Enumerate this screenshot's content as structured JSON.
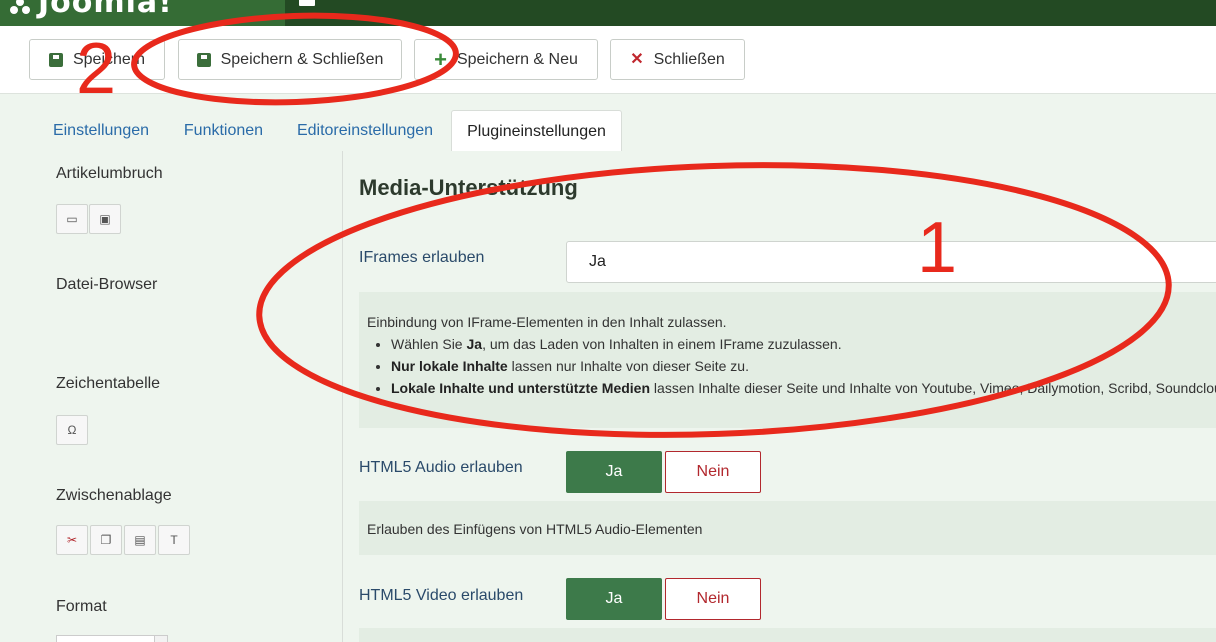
{
  "header": {
    "logo_text": "Joomla!",
    "accent_color": "#234a23"
  },
  "toolbar": {
    "save_label": "Speichern",
    "save_close_label": "Speichern & Schließen",
    "save_new_label": "Speichern & Neu",
    "close_label": "Schließen"
  },
  "tabs": [
    {
      "label": "Einstellungen"
    },
    {
      "label": "Funktionen"
    },
    {
      "label": "Editoreinstellungen"
    },
    {
      "label": "Plugineinstellungen",
      "active": true
    }
  ],
  "sidebar": {
    "sections": [
      {
        "label": "Artikelumbruch"
      },
      {
        "label": "Datei-Browser"
      },
      {
        "label": "Zeichentabelle"
      },
      {
        "label": "Zwischenablage"
      },
      {
        "label": "Format"
      }
    ]
  },
  "main": {
    "section_title": "Media-Unterstützung",
    "iframes": {
      "label": "IFrames erlauben",
      "value": "Ja",
      "description_intro": "Einbindung von IFrame-Elementen in den Inhalt zulassen.",
      "bullet1_bold": "Ja",
      "bullet1_pre": "Wählen Sie ",
      "bullet1_post": ", um das Laden von Inhalten in einem IFrame zuzulassen.",
      "bullet2_bold": "Nur lokale Inhalte",
      "bullet2_post": " lassen nur Inhalte von dieser Seite zu.",
      "bullet3_bold": "Lokale Inhalte und unterstützte Medien",
      "bullet3_post": " lassen Inhalte dieser Seite und Inhalte von Youtube, Vimeo, Dailymotion, Scribd, Soundcloud"
    },
    "audio": {
      "label": "HTML5 Audio erlauben",
      "yes": "Ja",
      "no": "Nein",
      "description": "Erlauben des Einfügens von HTML5 Audio-Elementen"
    },
    "video": {
      "label": "HTML5 Video erlauben",
      "yes": "Ja",
      "no": "Nein"
    }
  },
  "annotations": {
    "label1": "1",
    "label2": "2",
    "color": "#e8291c"
  }
}
